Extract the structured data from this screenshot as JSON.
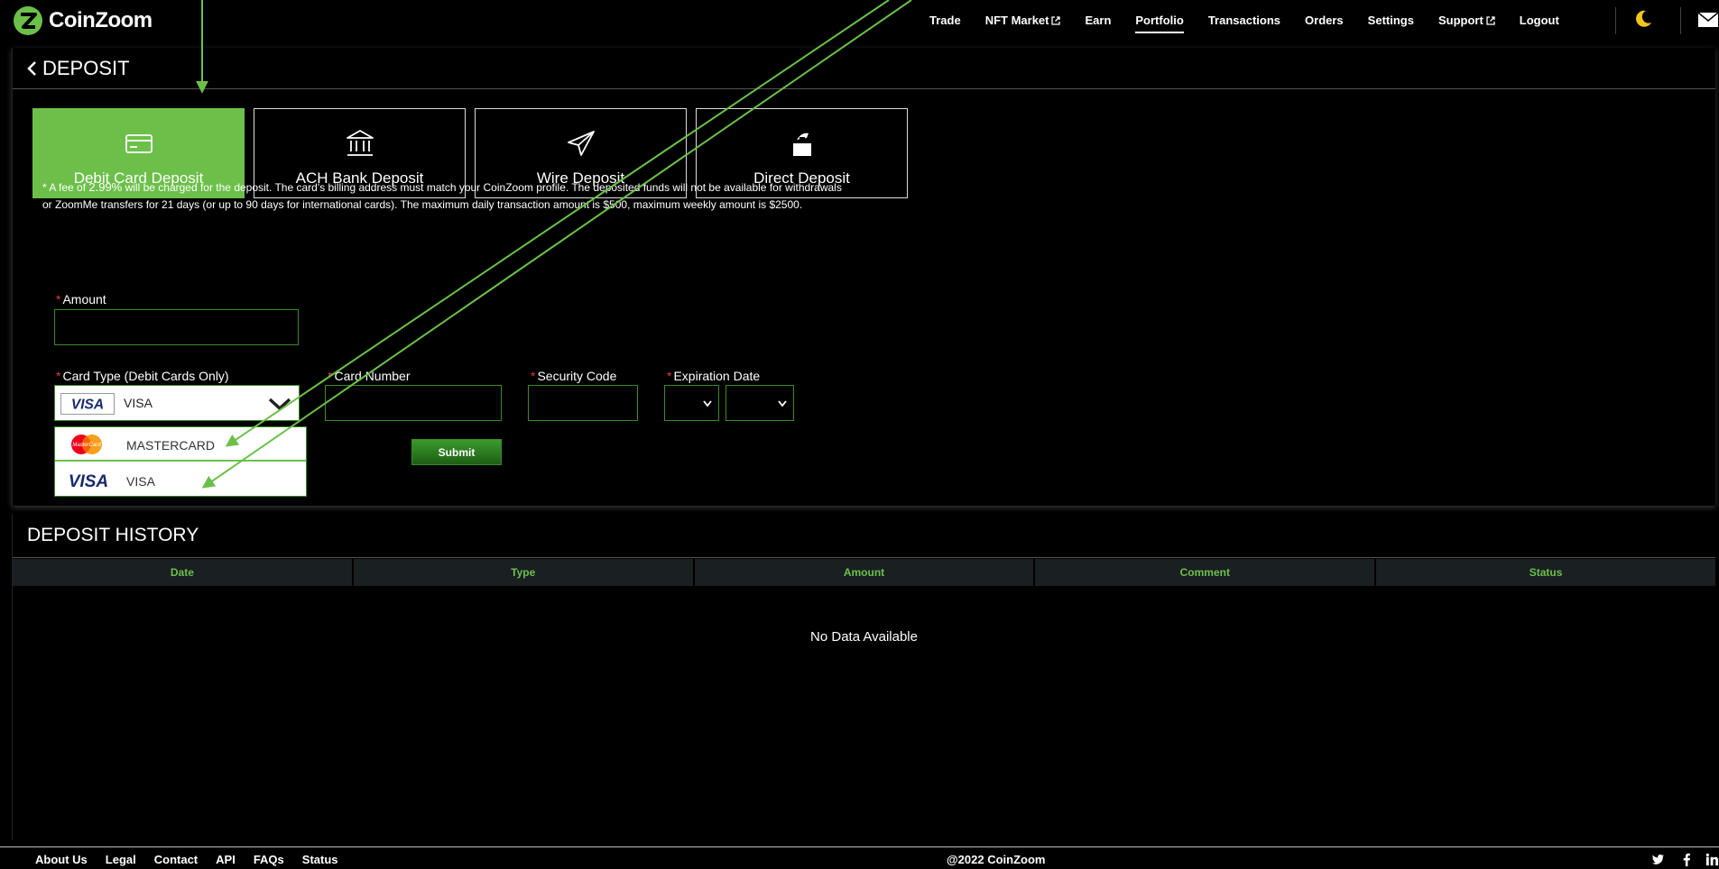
{
  "brand": {
    "name": "CoinZoom",
    "accent": "#6cc04a"
  },
  "nav": {
    "items": [
      {
        "label": "Trade",
        "external": false
      },
      {
        "label": "NFT Market",
        "external": true
      },
      {
        "label": "Earn",
        "external": false
      },
      {
        "label": "Portfolio",
        "external": false,
        "active": true
      },
      {
        "label": "Transactions",
        "external": false
      },
      {
        "label": "Orders",
        "external": false
      },
      {
        "label": "Settings",
        "external": false
      },
      {
        "label": "Support",
        "external": true
      },
      {
        "label": "Logout",
        "external": false
      }
    ],
    "icons": [
      "moon-icon",
      "mail-icon"
    ]
  },
  "deposit": {
    "title": "DEPOSIT",
    "tabs": [
      {
        "label": "Debit Card Deposit",
        "icon": "credit-card-icon",
        "active": true
      },
      {
        "label": "ACH Bank Deposit",
        "icon": "bank-icon"
      },
      {
        "label": "Wire Deposit",
        "icon": "paper-plane-icon"
      },
      {
        "label": "Direct Deposit",
        "icon": "hand-deposit-icon"
      }
    ],
    "notice_prefix": "* A fee of ",
    "notice_fee": "2.99%",
    "notice_rest": " will be charged for the deposit. The card's billing address must match your CoinZoom profile. The deposited funds will not be available for withdrawals or ZoomMe transfers for 21 days (or up to 90 days for international cards). The maximum daily transaction amount is $500, maximum weekly amount is $2500.",
    "form": {
      "required_mark": "*",
      "amount_label": "Amount",
      "amount_value": "",
      "card_type_label": "Card Type (Debit Cards Only)",
      "card_type_value": "VISA",
      "card_number_label": "Card Number",
      "card_number_value": "",
      "security_code_label": "Security Code",
      "security_code_value": "",
      "expiration_label": "Expiration Date",
      "exp_month_value": "",
      "exp_year_value": "",
      "submit_label": "Submit",
      "card_options": [
        {
          "label": "MASTERCARD",
          "logo": "mastercard-logo",
          "logo_text": "MasterCard"
        },
        {
          "label": "VISA",
          "logo": "visa-logo",
          "logo_text": "VISA"
        }
      ],
      "visa_badge_text": "VISA"
    }
  },
  "history": {
    "title": "DEPOSIT HISTORY",
    "columns": [
      "Date",
      "Type",
      "Amount",
      "Comment",
      "Status"
    ],
    "empty_text": "No Data Available"
  },
  "footer": {
    "links": [
      "About Us",
      "Legal",
      "Contact",
      "API",
      "FAQs",
      "Status"
    ],
    "copyright": "@2022 CoinZoom",
    "social": [
      "twitter-icon",
      "facebook-icon",
      "linkedin-icon"
    ]
  }
}
